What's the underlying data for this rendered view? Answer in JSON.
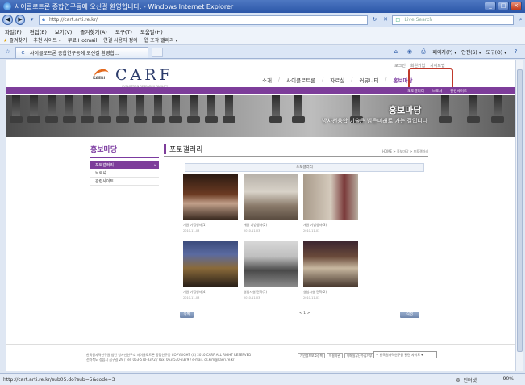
{
  "window": {
    "title": "사이클로트론 종합연구동에 오신걸 환영합니다. - Windows Internet Explorer"
  },
  "address": {
    "url": "http://cart.arti.re.kr/",
    "search_placeholder": "Live Search"
  },
  "menu": [
    "파일(F)",
    "편집(E)",
    "보기(V)",
    "즐겨찾기(A)",
    "도구(T)",
    "도움말(H)"
  ],
  "favorites": {
    "label": "즐겨찾기",
    "items": [
      "추천 사이트 ▾",
      "무료 Hotmail",
      "연결 사용자 정의",
      "웹 조각 갤러리 ▾"
    ]
  },
  "tab": {
    "title": "사이클로트론 종합연구동에 오신걸 환영합..."
  },
  "commands": [
    "페이지(P) ▾",
    "안전(S) ▾",
    "도구(O) ▾"
  ],
  "site": {
    "util_links": [
      "로그인",
      "회원가입",
      "사이트맵"
    ],
    "logo_name": "CARF",
    "logo_sub": "CYCLOTRON RESEARCH FACILITY",
    "gnb": [
      "소개",
      "사이클로트론",
      "자료실",
      "커뮤니티",
      "홍보마당"
    ],
    "subnav": [
      "포토갤러리",
      "브로셔",
      "관련사이트"
    ],
    "banner_title": "홍보마당",
    "banner_slogan": "방사선융합 기술은 밝은미래로 가는 길입니다",
    "lnb_title": "홍보마당",
    "lnb_items": [
      "포토갤러리",
      "브로셔",
      "관련사이트"
    ],
    "content_title": "포토갤러리",
    "breadcrumb": "HOME > 홍보마당 > 포토갤러리",
    "board_label": "포토갤러리",
    "photos": [
      {
        "caption": "개원 기념행사(1)",
        "date": "2010-11-03"
      },
      {
        "caption": "개원 기념행사(2)",
        "date": "2010-11-03"
      },
      {
        "caption": "개원 기념행사(3)",
        "date": "2010-11-03"
      },
      {
        "caption": "개원 기념행사(4)",
        "date": "2010-11-03"
      },
      {
        "caption": "실험시설 견학(1)",
        "date": "2010-11-03"
      },
      {
        "caption": "실험시설 견학(2)",
        "date": "2010-11-03"
      }
    ],
    "list_button": "목록",
    "pager": "< 1 >",
    "write_button": "작성",
    "footer_addr": "한국원자력연구원 첨단 방사선연구소 사이클로트론 종합연구동 COPYRIGHT (C) 2010 CARF ALL RIGHT RESERVED",
    "footer_addr2": "전라북도 정읍시 금구길 29  /  Tel. 063-570-3372  /  Fax. 063-570-3379  /  e-mail. cs.kim@kaeri.re.kr",
    "footer_links": [
      "개인정보보호정책",
      "이용약관",
      "이메일무단수집거부"
    ],
    "family_site": "+ 한국원자력연구원 관련 사이트 ▾"
  },
  "status": {
    "url": "http://cart.arti.re.kr/sub05.do?sub=5&code=3",
    "zone": "인터넷",
    "zoom": "90%"
  }
}
